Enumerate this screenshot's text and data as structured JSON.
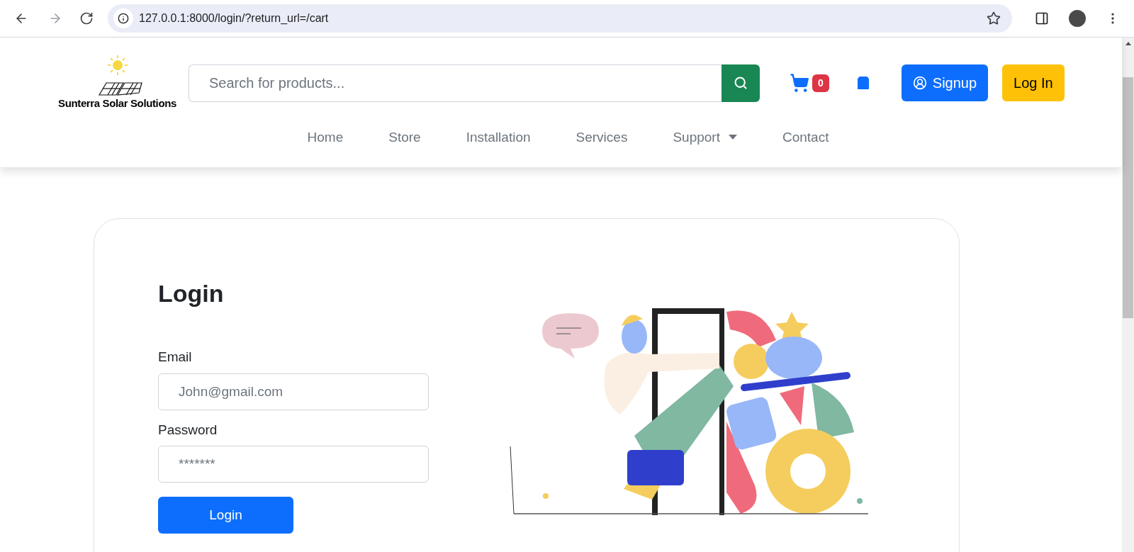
{
  "browser": {
    "url": "127.0.0.1:8000/login/?return_url=/cart"
  },
  "header": {
    "brand": "Sunterra Solar Solutions",
    "search": {
      "placeholder": "Search for products..."
    },
    "cart_count": "0",
    "signup": "Signup",
    "login": "Log In"
  },
  "nav": [
    {
      "label": "Home",
      "has_menu": false
    },
    {
      "label": "Store",
      "has_menu": false
    },
    {
      "label": "Installation",
      "has_menu": false
    },
    {
      "label": "Services",
      "has_menu": false
    },
    {
      "label": "Support",
      "has_menu": true
    },
    {
      "label": "Contact",
      "has_menu": false
    }
  ],
  "login_form": {
    "title": "Login",
    "fields": [
      {
        "label": "Email",
        "placeholder": "John@gmail.com"
      },
      {
        "label": "Password",
        "placeholder": "*******"
      }
    ],
    "submit": "Login"
  }
}
